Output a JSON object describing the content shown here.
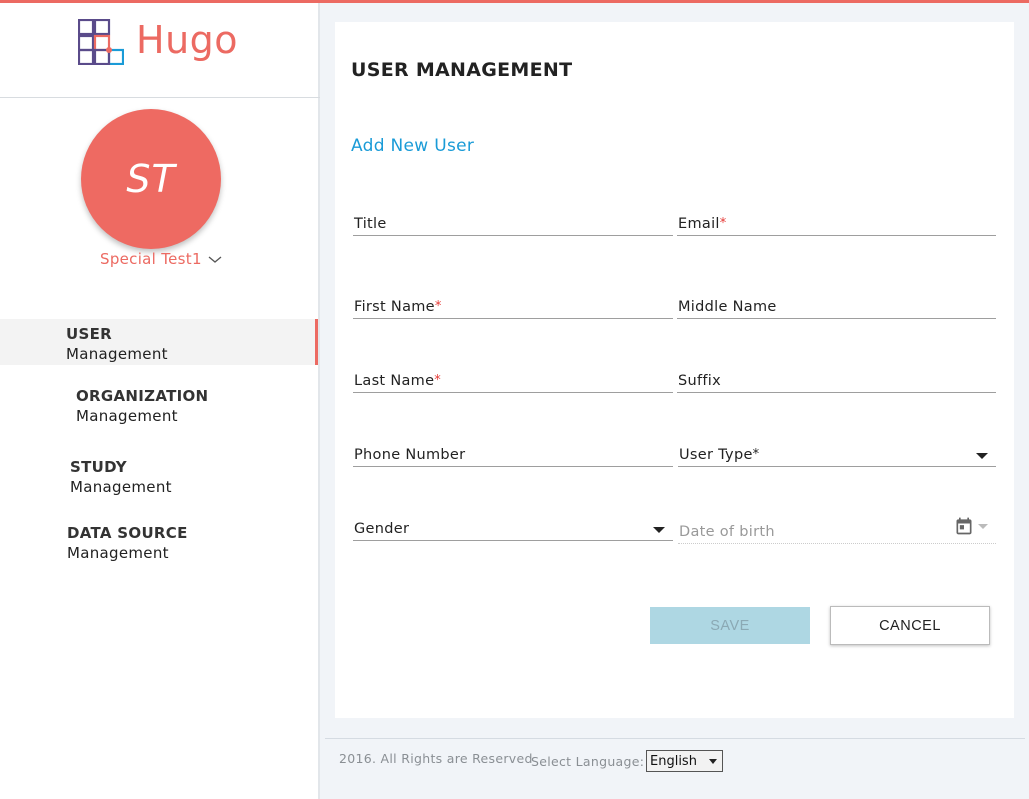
{
  "brand": {
    "name": "Hugo",
    "accent": "#ec6a62",
    "link_color": "#1a9bd7"
  },
  "user": {
    "initials": "ST",
    "name": "Special Test1"
  },
  "nav": [
    {
      "title": "USER",
      "subtitle": "Management",
      "active": true
    },
    {
      "title": "ORGANIZATION",
      "subtitle": "Management",
      "active": false
    },
    {
      "title": "STUDY",
      "subtitle": "Management",
      "active": false
    },
    {
      "title": "DATA SOURCE",
      "subtitle": "Management",
      "active": false
    }
  ],
  "page": {
    "title": "USER MANAGEMENT",
    "add_link": "Add New User"
  },
  "form": {
    "title": {
      "label": "Title"
    },
    "email": {
      "label": "Email",
      "required": "*"
    },
    "first_name": {
      "label": "First Name",
      "required": "*"
    },
    "middle_name": {
      "label": "Middle Name"
    },
    "last_name": {
      "label": "Last Name",
      "required": "*"
    },
    "suffix": {
      "label": "Suffix"
    },
    "phone": {
      "label": "Phone Number"
    },
    "user_type": {
      "label": "User Type",
      "required": "*"
    },
    "gender": {
      "label": "Gender"
    },
    "dob": {
      "placeholder": "Date of birth"
    },
    "save_label": "SAVE",
    "cancel_label": "CANCEL"
  },
  "footer": {
    "copyright": "2016. All Rights are Reserved",
    "language_label": "Select Language:",
    "language_value": "English"
  },
  "icons": {
    "logo": "hugo-logo-icon",
    "chevron": "chevron-down-icon",
    "calendar": "calendar-icon",
    "caret": "caret-down-icon"
  }
}
